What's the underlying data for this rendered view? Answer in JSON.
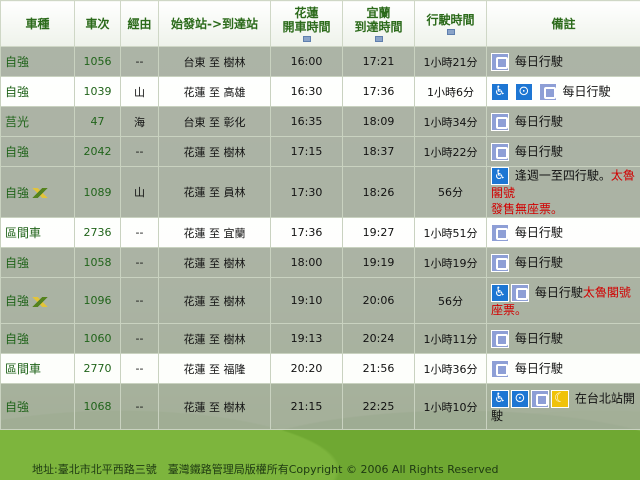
{
  "headers": {
    "type": "車種",
    "number": "車次",
    "via": "經由",
    "route": "始發站->到達站",
    "depart_l1": "花蓮",
    "depart_l2": "開車時間",
    "arrive_l1": "宜蘭",
    "arrive_l2": "到達時間",
    "duration": "行駛時間",
    "notes": "備註"
  },
  "rows": [
    {
      "type": "自強",
      "num": "1056",
      "via": "--",
      "route": "台東 至 樹林",
      "dep": "16:00",
      "arr": "17:21",
      "dur": "1小時21分",
      "note": "每日行駛"
    },
    {
      "type": "自強",
      "num": "1039",
      "via": "山",
      "route": "花蓮 至 高雄",
      "dep": "16:30",
      "arr": "17:36",
      "dur": "1小時6分",
      "note": "每日行駛"
    },
    {
      "type": "莒光",
      "num": "47",
      "via": "海",
      "route": "台東 至 彰化",
      "dep": "16:35",
      "arr": "18:09",
      "dur": "1小時34分",
      "note": "每日行駛"
    },
    {
      "type": "自強",
      "num": "2042",
      "via": "--",
      "route": "花蓮 至 樹林",
      "dep": "17:15",
      "arr": "18:37",
      "dur": "1小時22分",
      "note": "每日行駛"
    },
    {
      "type": "自強",
      "num": "1089",
      "via": "山",
      "route": "花蓮 至 員林",
      "dep": "17:30",
      "arr": "18:26",
      "dur": "56分",
      "note": "逢週一至四行駛。",
      "note_red": "太魯閣號",
      "note2": "發售無座票。"
    },
    {
      "type": "區間車",
      "num": "2736",
      "via": "--",
      "route": "花蓮 至 宜蘭",
      "dep": "17:36",
      "arr": "19:27",
      "dur": "1小時51分",
      "note": "每日行駛"
    },
    {
      "type": "自強",
      "num": "1058",
      "via": "--",
      "route": "花蓮 至 樹林",
      "dep": "18:00",
      "arr": "19:19",
      "dur": "1小時19分",
      "note": "每日行駛"
    },
    {
      "type": "自強",
      "num": "1096",
      "via": "--",
      "route": "花蓮 至 樹林",
      "dep": "19:10",
      "arr": "20:06",
      "dur": "56分",
      "note": "每日行駛",
      "note_red": "太魯閣號",
      "note2": "座票。"
    },
    {
      "type": "自強",
      "num": "1060",
      "via": "--",
      "route": "花蓮 至 樹林",
      "dep": "19:13",
      "arr": "20:24",
      "dur": "1小時11分",
      "note": "每日行駛"
    },
    {
      "type": "區間車",
      "num": "2770",
      "via": "--",
      "route": "花蓮 至 福隆",
      "dep": "20:20",
      "arr": "21:56",
      "dur": "1小時36分",
      "note": "每日行駛"
    },
    {
      "type": "自強",
      "num": "1068",
      "via": "--",
      "route": "花蓮 至 樹林",
      "dep": "21:15",
      "arr": "22:25",
      "dur": "1小時10分",
      "note": "在台北站開",
      "note2": "駛"
    }
  ],
  "footer": "地址:臺北市北平西路三號　臺灣鐵路管理局版權所有Copyright © 2006 All Rights Reserved",
  "colors": {
    "accent_green": "#21641b",
    "red_note": "#d10000",
    "train_icon": "#8e9fd6",
    "access_icon": "#1d76d3",
    "night_icon": "#f0c20a"
  }
}
